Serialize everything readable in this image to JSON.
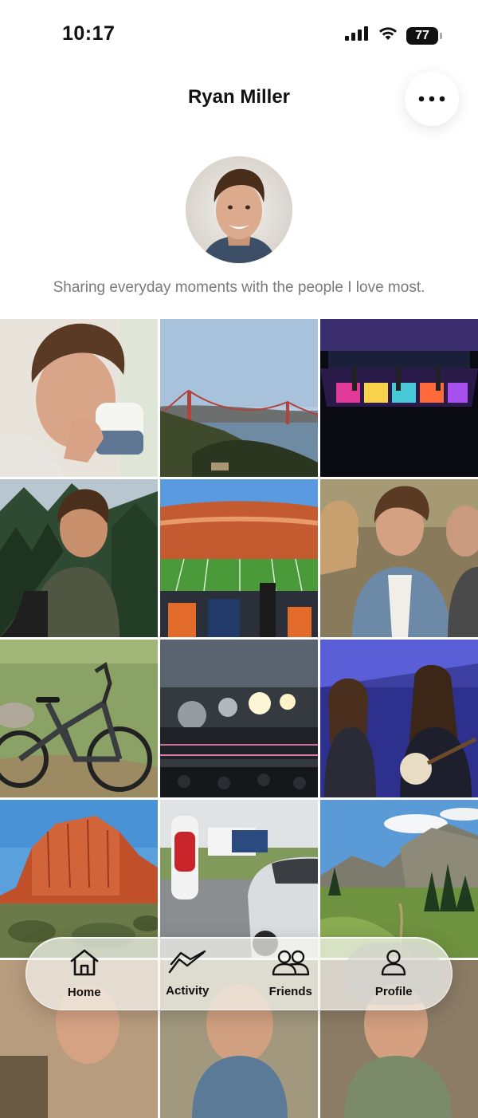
{
  "status_bar": {
    "time": "10:17",
    "battery": "77",
    "icons": [
      "cellular-signal-icon",
      "wifi-icon",
      "battery-icon"
    ]
  },
  "header": {
    "title": "Ryan Miller",
    "more_icon": "ellipsis-icon"
  },
  "profile": {
    "bio": "Sharing everyday moments with the people I love most."
  },
  "photos": [
    {
      "subject": "man-drinking-from-mug"
    },
    {
      "subject": "golden-gate-bridge"
    },
    {
      "subject": "concert-stage-lights"
    },
    {
      "subject": "man-hiking-forest"
    },
    {
      "subject": "football-stadium"
    },
    {
      "subject": "friends-laughing"
    },
    {
      "subject": "mountain-bike-meadow"
    },
    {
      "subject": "concert-hall-stage"
    },
    {
      "subject": "musicians-banjo"
    },
    {
      "subject": "red-rock-butte"
    },
    {
      "subject": "tesla-supercharger"
    },
    {
      "subject": "mountain-valley-trail"
    }
  ],
  "tab_bar": {
    "tabs": [
      {
        "label": "Home",
        "icon": "house-icon"
      },
      {
        "label": "Activity",
        "icon": "activity-chart-icon"
      },
      {
        "label": "Friends",
        "icon": "friends-icon"
      },
      {
        "label": "Profile",
        "icon": "person-icon"
      }
    ],
    "active": "Profile"
  },
  "colors": {
    "accent": "#111111",
    "bio_text": "#7a7a7a"
  }
}
